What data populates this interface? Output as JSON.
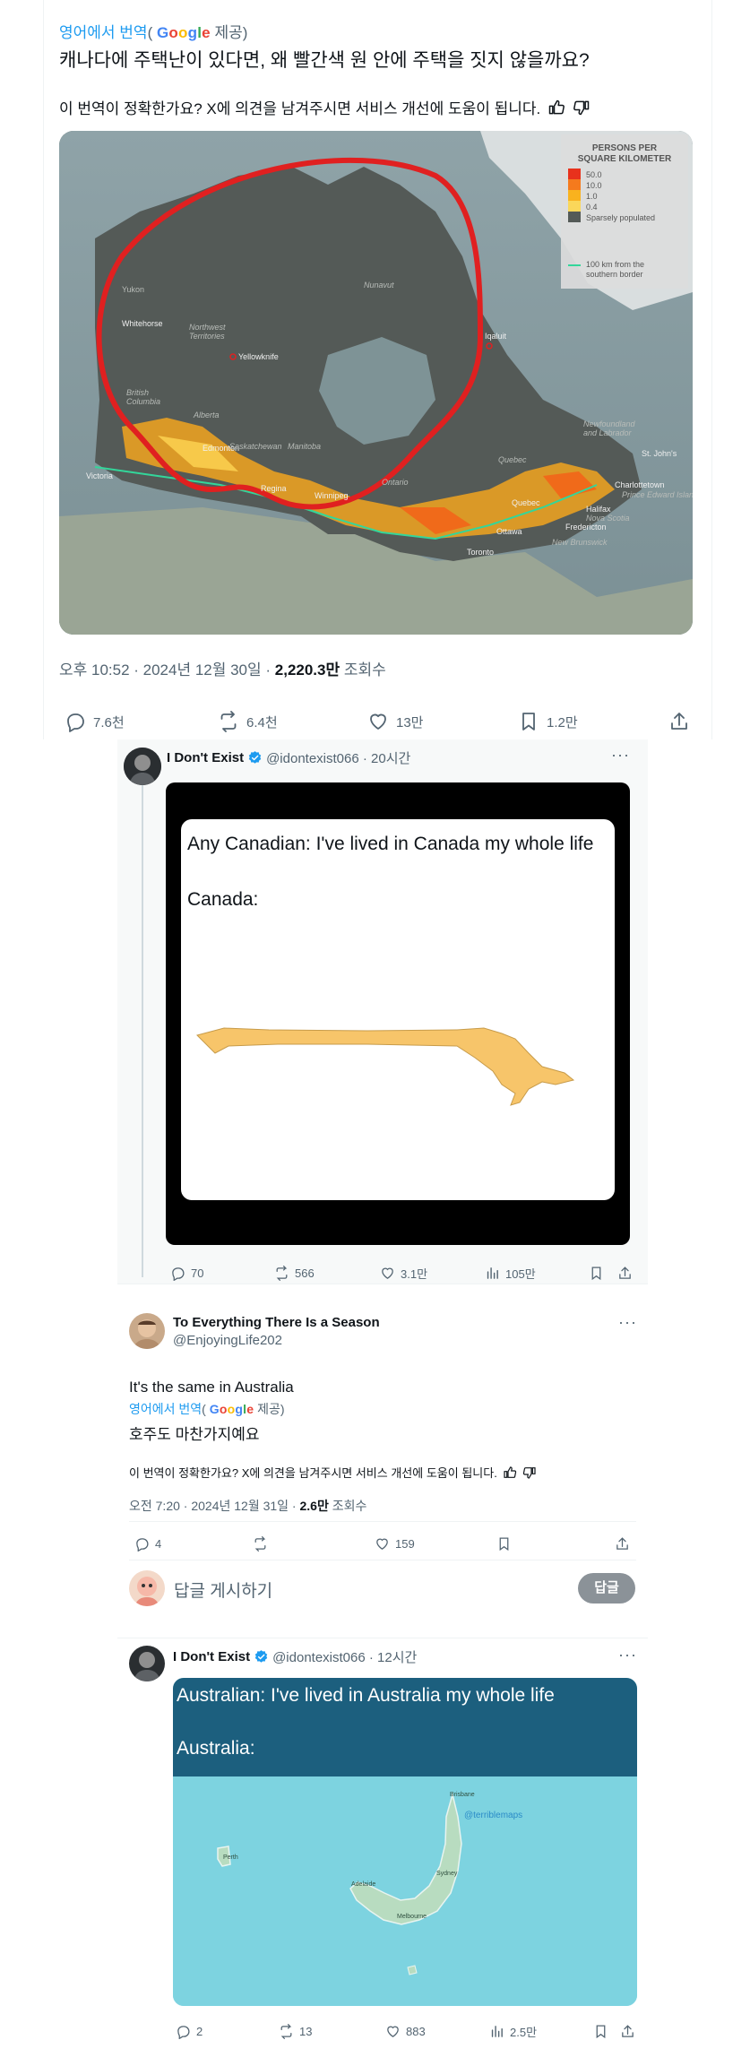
{
  "main_tweet": {
    "translate_prefix": "영어에서 번역",
    "translate_open": "(",
    "google_letters": [
      "G",
      "o",
      "o",
      "g",
      "l",
      "e"
    ],
    "translate_suffix": "제공)",
    "text": "캐나다에 주택난이 있다면, 왜 빨간색 원 안에 주택을 짓지 않을까요?",
    "feedback": "이 번역이 정확한가요? X에 의견을 남겨주시면 서비스 개선에 도움이 됩니다.",
    "map": {
      "legend_title_1": "PERSONS PER",
      "legend_title_2": "SQUARE KILOMETER",
      "legend_items": [
        "50.0",
        "10.0",
        "1.0",
        "0.4",
        "Sparsely populated"
      ],
      "legend_line_1": "100 km from the",
      "legend_line_2": "southern border",
      "places": {
        "yukon": "Yukon",
        "whitehorse": "Whitehorse",
        "nwt_1": "Northwest",
        "nwt_2": "Territories",
        "yellowknife": "Yellowknife",
        "nunavut": "Nunavut",
        "iqaluit": "Iqaluit",
        "bc_1": "British",
        "bc_2": "Columbia",
        "alberta": "Alberta",
        "edmonton": "Edmonton",
        "saskatchewan": "Saskatchewan",
        "manitoba": "Manitoba",
        "regina": "Regina",
        "winnipeg": "Winnipeg",
        "victoria": "Victoria",
        "ontario": "Ontario",
        "quebec": "Quebec",
        "quebec_city": "Quebec",
        "nfl_1": "Newfoundland",
        "nfl_2": "and Labrador",
        "stjohns": "St. John's",
        "charlottetown": "Charlottetown",
        "pei": "Prince Edward Island",
        "halifax": "Halifax",
        "novascotia": "Nova Scotia",
        "fredericton": "Fredericton",
        "newbrunswick": "New Brunswick",
        "ottawa": "Ottawa",
        "toronto": "Toronto"
      }
    },
    "meta_time": "오후 10:52 · 2024년 12월 30일 · ",
    "meta_views": "2,220.3만",
    "meta_views_label": " 조회수",
    "actions": {
      "replies": "7.6천",
      "reposts": "6.4천",
      "likes": "13만",
      "bookmarks": "1.2만"
    }
  },
  "reply_1": {
    "name": "I Don't Exist",
    "handle": "@idontexist066 · 20시간",
    "more": "···",
    "meme_line_1": "Any Canadian: I've lived in Canada my whole life",
    "meme_line_2": "Canada:",
    "actions": {
      "replies": "70",
      "reposts": "566",
      "likes": "3.1만",
      "views": "105만"
    }
  },
  "reply_2": {
    "name": "To Everything There Is a Season",
    "handle": "@EnjoyingLife202",
    "more": "···",
    "text": "It's the same in Australia",
    "translate_prefix": "영어에서 번역",
    "translate_open": "(",
    "google_letters": [
      "G",
      "o",
      "o",
      "g",
      "l",
      "e"
    ],
    "translate_suffix": "제공)",
    "text_ko": "호주도 마찬가지예요",
    "feedback": "이 번역이 정확한가요? X에 의견을 남겨주시면 서비스 개선에 도움이 됩니다.",
    "meta_time": "오전 7:20 · 2024년 12월 31일 · ",
    "meta_views": "2.6만",
    "meta_views_label": " 조회수",
    "actions": {
      "replies": "4",
      "reposts": "",
      "likes": "159"
    }
  },
  "compose": {
    "placeholder": "답글 게시하기",
    "button": "답글"
  },
  "reply_3": {
    "name": "I Don't Exist",
    "handle": "@idontexist066 · 12시간",
    "more": "···",
    "meme_line_1": "Australian: I've lived in Australia my whole life",
    "meme_line_2": "Australia:",
    "watermark": "@terriblemaps",
    "places": {
      "perth": "Perth",
      "adelaide": "Adelaide",
      "melbourne": "Melbourne",
      "sydney": "Sydney",
      "brisbane": "Brisbane"
    },
    "actions": {
      "replies": "2",
      "reposts": "13",
      "likes": "883",
      "views": "2.5만"
    }
  },
  "colors": {
    "accent": "#1d9bf0",
    "text": "#0f1419",
    "muted": "#536471",
    "circle": "#e02020",
    "verified": "#1d9bf0"
  }
}
